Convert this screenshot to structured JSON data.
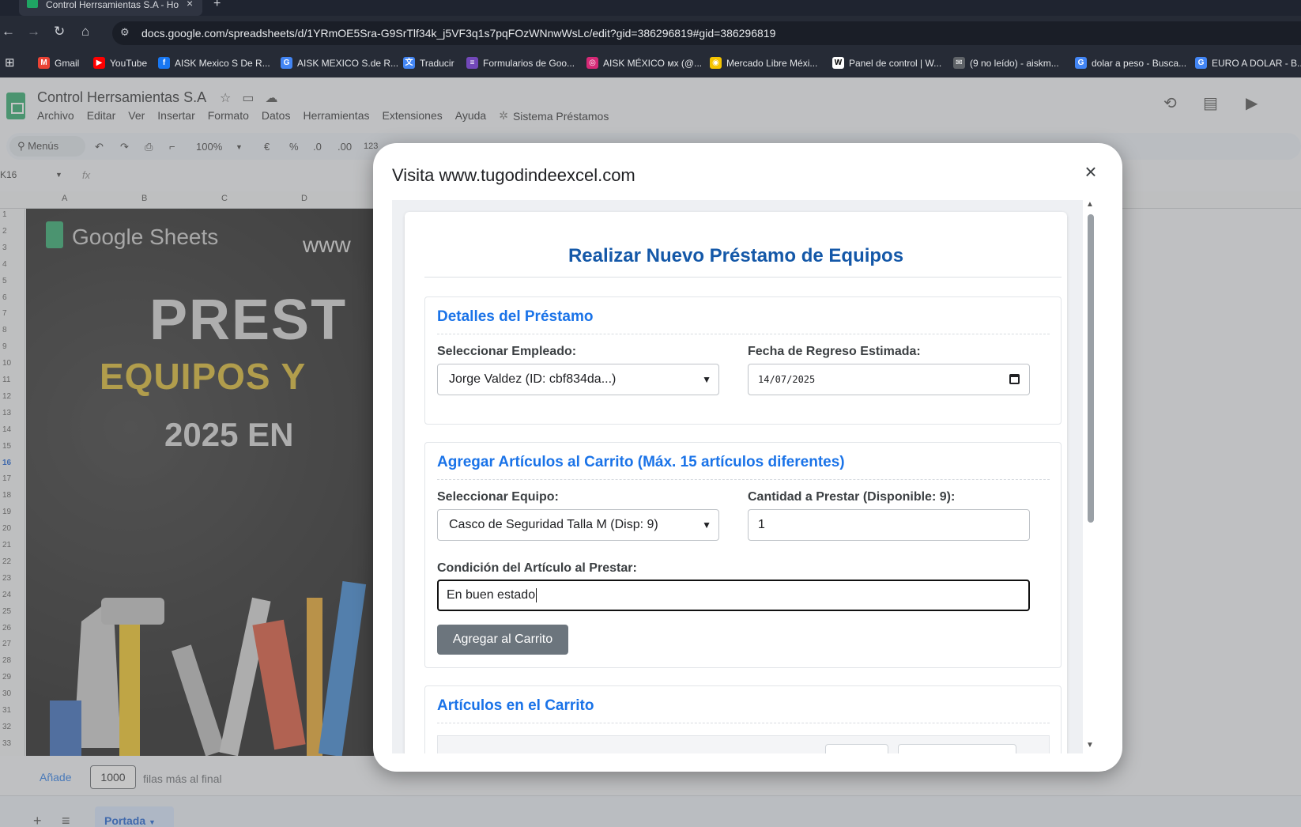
{
  "browser": {
    "tab_title": "Control Herrsamientas S.A - Ho",
    "url": "docs.google.com/spreadsheets/d/1YRmOE5Sra-G9SrTlf34k_j5VF3q1s7pqFOzWNnwWsLc/edit?gid=386296819#gid=386296819",
    "bookmarks": [
      {
        "label": "Gmail",
        "icon": "gmail-icon",
        "color": "#ea4335",
        "glyph": "M"
      },
      {
        "label": "YouTube",
        "icon": "youtube-icon",
        "color": "#ff0000",
        "glyph": "▶"
      },
      {
        "label": "AISK Mexico S De R...",
        "icon": "facebook-icon",
        "color": "#1877f2",
        "glyph": "f"
      },
      {
        "label": "AISK MEXICO S.de R...",
        "icon": "google-icon",
        "color": "#4285f4",
        "glyph": "G"
      },
      {
        "label": "Traducir",
        "icon": "translate-icon",
        "color": "#4285f4",
        "glyph": "文"
      },
      {
        "label": "Formularios de Goo...",
        "icon": "forms-icon",
        "color": "#7248b9",
        "glyph": "≡"
      },
      {
        "label": "AISK MÉXICO ᴍx (@...",
        "icon": "instagram-icon",
        "color": "#d62976",
        "glyph": "◎"
      },
      {
        "label": "Mercado Libre Méxi...",
        "icon": "mercadolibre-icon",
        "color": "#f5c400",
        "glyph": "◉"
      },
      {
        "label": "Panel de control | W...",
        "icon": "wix-icon",
        "color": "#ffffff",
        "glyph": "W"
      },
      {
        "label": "(9 no leído) - aiskm...",
        "icon": "mail-icon",
        "color": "#5f6368",
        "glyph": "✉"
      },
      {
        "label": "dolar a peso - Busca...",
        "icon": "google-icon",
        "color": "#4285f4",
        "glyph": "G"
      },
      {
        "label": "EURO A DOLAR - B...",
        "icon": "google-icon",
        "color": "#4285f4",
        "glyph": "G"
      }
    ]
  },
  "sheets": {
    "doc_title": "Control Herrsamientas S.A",
    "menu": [
      "Archivo",
      "Editar",
      "Ver",
      "Insertar",
      "Formato",
      "Datos",
      "Herramientas",
      "Extensiones",
      "Ayuda"
    ],
    "custom_menu": "Sistema Préstamos",
    "toolbar": {
      "menus": "Menús",
      "zoom": "100%",
      "currency": "€",
      "percent": "%",
      "dec_less": ".0",
      "dec_more": ".00",
      "number": "123"
    },
    "cell_ref": "K16",
    "fx": "fx",
    "columns": [
      "A",
      "B",
      "C",
      "D"
    ],
    "rows": [
      "1",
      "2",
      "3",
      "4",
      "5",
      "6",
      "7",
      "8",
      "9",
      "10",
      "11",
      "12",
      "13",
      "14",
      "15",
      "16",
      "17",
      "18",
      "19",
      "20",
      "21",
      "22",
      "23",
      "24",
      "25",
      "26",
      "27",
      "28",
      "29",
      "30",
      "31",
      "32",
      "33"
    ],
    "banner": {
      "brand": "Google Sheets",
      "www": "www",
      "line1": "PREST",
      "line2": "EQUIPOS Y",
      "line3": "2025 EN"
    },
    "add_rows": {
      "link": "Añade",
      "count": "1000",
      "suffix": "filas más al final"
    },
    "sheet_tab": "Portada"
  },
  "modal": {
    "title": "Visita www.tugodindeexcel.com",
    "close": "×",
    "heading": "Realizar Nuevo Préstamo de Equipos",
    "details": {
      "title": "Detalles del Préstamo",
      "employee_label": "Seleccionar Empleado:",
      "employee_value": "Jorge Valdez (ID: cbf834da...)",
      "return_label": "Fecha de Regreso Estimada:",
      "return_value": "14/07/2025"
    },
    "add_items": {
      "title": "Agregar Artículos al Carrito (Máx. 15 artículos diferentes)",
      "equipment_label": "Seleccionar Equipo:",
      "equipment_value": "Casco de Seguridad Talla M (Disp: 9)",
      "quantity_label": "Cantidad a Prestar (Disponible: 9):",
      "quantity_value": "1",
      "condition_label": "Condición del Artículo al Prestar:",
      "condition_value": "En buen estado",
      "add_button": "Agregar al Carrito"
    },
    "cart": {
      "title": "Artículos en el Carrito"
    }
  }
}
